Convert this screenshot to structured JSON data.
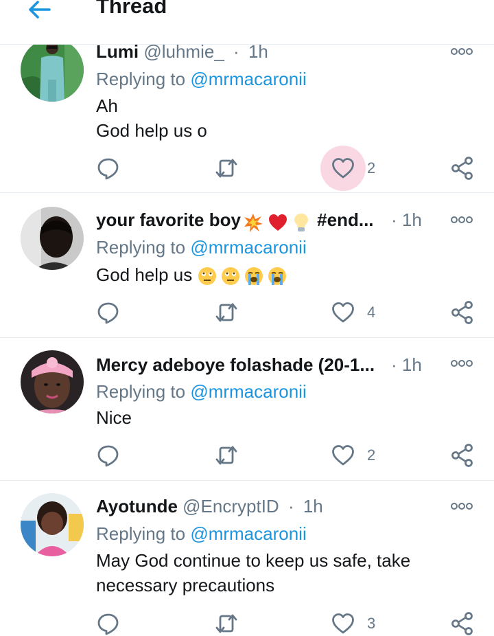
{
  "header": {
    "title": "Thread"
  },
  "tweets": [
    {
      "name": "Lumi",
      "handle": "@luhmie_",
      "time": "1h",
      "replying_prefix": "Replying to",
      "mention": "@mrmacaronii",
      "text_lines": [
        "Ah",
        "God help us o"
      ],
      "likes": "2"
    },
    {
      "name_prefix": "your favorite boy",
      "name_suffix": "#end...",
      "time": "1h",
      "replying_prefix": "Replying to",
      "mention": "@mrmacaronii",
      "text": "God help us",
      "likes": "4"
    },
    {
      "name": "Mercy adeboye folashade (20-1...",
      "time": "1h",
      "replying_prefix": "Replying to",
      "mention": "@mrmacaronii",
      "text": "Nice",
      "likes": "2"
    },
    {
      "name": "Ayotunde",
      "handle": "@EncryptID",
      "time": "1h",
      "replying_prefix": "Replying to",
      "mention": "@mrmacaronii",
      "text_lines": [
        "May God continue to keep us safe, take",
        "necessary precautions"
      ],
      "likes": "3"
    }
  ],
  "colors": {
    "accent": "#1b95e0",
    "secondary_text": "#657786",
    "like_highlight": "#f9d8e3",
    "divider": "#e6ecf0"
  },
  "icons": [
    "back-arrow-icon",
    "reply-icon",
    "retweet-icon",
    "heart-icon",
    "share-icon",
    "more-icon"
  ]
}
